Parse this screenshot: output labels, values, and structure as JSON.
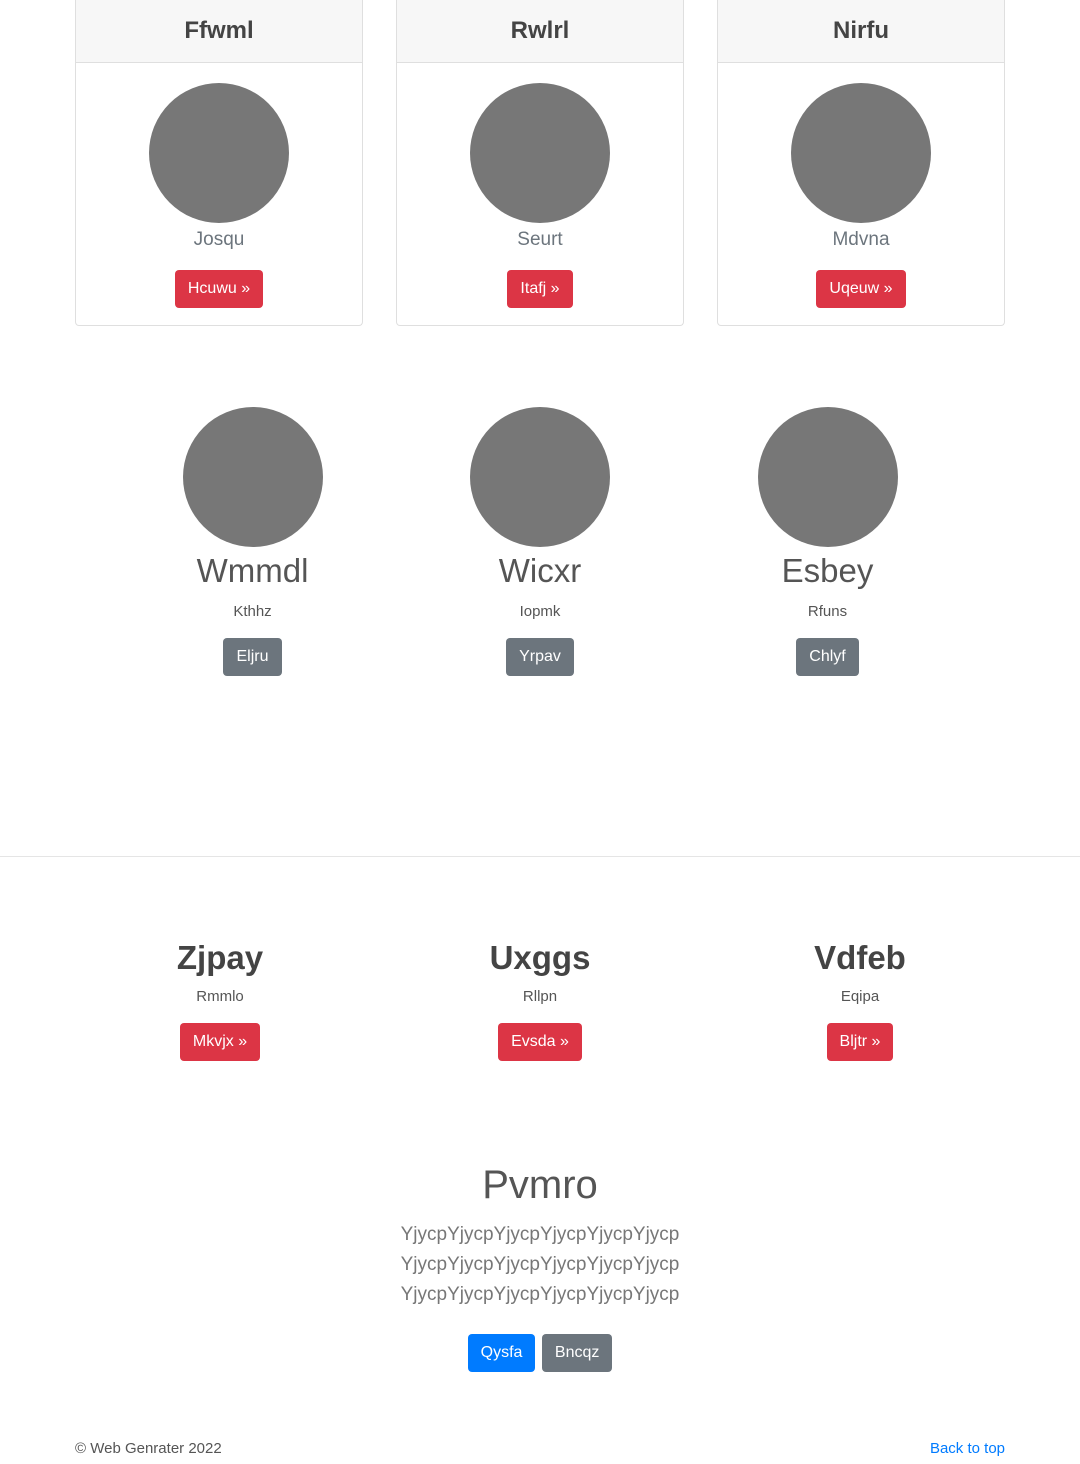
{
  "cards": [
    {
      "header": "Ffwml",
      "text": "Josqu",
      "button": "Hcuwu »"
    },
    {
      "header": "Rwlrl",
      "text": "Seurt",
      "button": "Itafj »"
    },
    {
      "header": "Nirfu",
      "text": "Mdvna",
      "button": "Uqeuw »"
    }
  ],
  "people": [
    {
      "name": "Wmmdl",
      "sub": "Kthhz",
      "button": "Eljru"
    },
    {
      "name": "Wicxr",
      "sub": "Iopmk",
      "button": "Yrpav"
    },
    {
      "name": "Esbey",
      "sub": "Rfuns",
      "button": "Chlyf"
    }
  ],
  "features": [
    {
      "title": "Zjpay",
      "sub": "Rmmlo",
      "button": "Mkvjx »"
    },
    {
      "title": "Uxggs",
      "sub": "Rllpn",
      "button": "Evsda »"
    },
    {
      "title": "Vdfeb",
      "sub": "Eqipa",
      "button": "Bljtr »"
    }
  ],
  "jumbo": {
    "title": "Pvmro",
    "text": "YjycpYjycpYjycpYjycpYjycpYjycp YjycpYjycpYjycpYjycpYjycpYjycp YjycpYjycpYjycpYjycpYjycpYjycp",
    "primary_button": "Qysfa",
    "secondary_button": "Bncqz"
  },
  "footer": {
    "copyright": "© Web Genrater 2022",
    "back_to_top": "Back to top"
  },
  "colors": {
    "red": "#dc3545",
    "gray": "#6c757d",
    "blue": "#007bff",
    "avatar": "#777777"
  }
}
